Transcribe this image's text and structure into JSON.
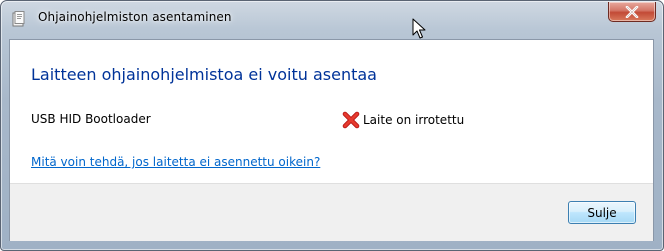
{
  "window": {
    "title": "Ohjainohjelmiston asentaminen",
    "close_icon": "close-icon"
  },
  "content": {
    "heading": "Laitteen ohjainohjelmistoa ei voitu asentaa",
    "device": {
      "name": "USB HID Bootloader",
      "status": "Laite on irrotettu",
      "status_icon": "error-x-icon"
    },
    "help_link": "Mitä voin tehdä, jos laitetta ei asennettu oikein?"
  },
  "footer": {
    "close_button": "Sulje"
  },
  "colors": {
    "heading": "#003399",
    "link": "#0066cc",
    "error": "#d21f1f"
  }
}
